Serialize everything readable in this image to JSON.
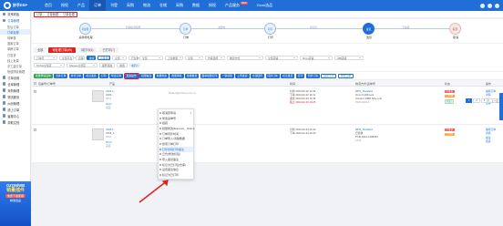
{
  "brand": {
    "name": "妙手ERP"
  },
  "topnav": {
    "items": [
      {
        "label": "首页"
      },
      {
        "label": "授权"
      },
      {
        "label": "产品"
      },
      {
        "label": "订单"
      },
      {
        "label": "刊登"
      },
      {
        "label": "采购"
      },
      {
        "label": "物流"
      },
      {
        "label": "仓储"
      },
      {
        "label": "采购"
      },
      {
        "label": "数据"
      },
      {
        "label": "授权"
      },
      {
        "label": "产品服务"
      },
      {
        "label": "Ozon选品"
      }
    ],
    "badge": "NEW"
  },
  "sidebar": {
    "sections": [
      {
        "label": "效率看板"
      },
      {
        "label": "订单管理"
      },
      {
        "label": "售后订单"
      },
      {
        "label": "订单处理"
      },
      {
        "label": "待审核"
      },
      {
        "label": "退款订单"
      },
      {
        "label": "草稿订单"
      },
      {
        "label": "已发货"
      },
      {
        "label": "线上批量"
      },
      {
        "label": "手工建订单"
      },
      {
        "label": "快递揽收管理"
      },
      {
        "label": "订单设置"
      },
      {
        "label": "仓库管理"
      },
      {
        "label": "采购管理"
      },
      {
        "label": "物流服务"
      },
      {
        "label": "纠纷管理"
      },
      {
        "label": "线上订单"
      },
      {
        "label": "客服中心"
      },
      {
        "label": "帮助文档"
      }
    ]
  },
  "promo": {
    "line1": "OZON/WB",
    "line2": "销量插件",
    "cta": "免费下载使用",
    "line4": "精准选品"
  },
  "breadcrumb": {
    "items": [
      "订单",
      "订单管理",
      "订单处理"
    ]
  },
  "flow": {
    "nodes": [
      "待处理",
      "订单",
      "打印",
      "发货",
      "取消"
    ],
    "labels": [
      "采购待处理",
      "订单",
      "打印",
      "发货",
      "取消"
    ],
    "hints": [
      "待审核/待处理",
      "处理中",
      "待打包",
      "已发货"
    ]
  },
  "tabs": [
    {
      "label": "全部",
      "count": "",
      "active": false
    },
    {
      "label": "待处理订单",
      "count": "(69)",
      "active": true
    },
    {
      "label": "待打印",
      "count": "(4)",
      "active": false
    },
    {
      "label": "已打印",
      "count": "(7)",
      "active": false
    }
  ],
  "filters": {
    "row1": [
      "订单号",
      "全部平台",
      "店铺",
      "搜索",
      "高级搜索",
      "全部",
      "已付款",
      "全部",
      "上架类型",
      "全部",
      "仓库选择",
      "物流方式",
      "全部店铺",
      "Ozon店铺",
      "WB店铺"
    ],
    "row2": [
      "TikTok全部店",
      "Shopee全部店",
      "展开筛选",
      "重置"
    ],
    "tag": "未配对"
  },
  "toolbar": {
    "buttons": [
      "批量申请运单",
      "合并订单",
      "拆分订单",
      "标记发货",
      "打印",
      "导出订单",
      "更多操作",
      "批量备注",
      "批量修改",
      "批量审核",
      "批量推送",
      "面单批量打印",
      "一键获取",
      "上传发货",
      "全部回传",
      "同步订单",
      "标记发货",
      "打印",
      "同步订单",
      "自定义列",
      "导出订单"
    ]
  },
  "table": {
    "headers": [
      "包裹号/订单号",
      "产品",
      "时间",
      "物流方式/运单号",
      "状态",
      "操作"
    ],
    "rows": [
      {
        "order_no": "2104-1-",
        "order_sub": "2103...",
        "sku_label": "SKU:",
        "platform": "Ozon",
        "tag": "来自",
        "email_mask": "hidden@privacy.ozon.ru",
        "time1": "付款 2024-02-22 11:06",
        "time2": "下单 2024-02-22 11:11",
        "time3": "发货 2024-02-23 11:06",
        "time4": "截止 2024-02-23 19:25",
        "logistics": "MPS_Standard",
        "logistics2": "Ozon Fulfillment",
        "logistics3": "Amazon FBM Ship (+2)",
        "logistics4": "PCR-0321-1",
        "status_tags": [
          "待发货",
          "已付款",
          "标记"
        ],
        "actions": [
          "编辑订单",
          "详情",
          "备注",
          "更多"
        ]
      },
      {
        "order_no": "3104-1-",
        "order_sub": "3154_1...",
        "sku_label": "SKU:",
        "platform": "Ozon",
        "tag": "来自",
        "email_mask": "",
        "time1": "付款 2024-02-24 16:42",
        "time2": "下单 2024-02-24 16:43",
        "time3": "",
        "time4": "",
        "logistics": "MPS_Standard",
        "logistics2": "已揽收",
        "logistics3": "PCR-0321-1298401",
        "logistics4": "1234",
        "status_tags": [
          "待发货",
          "已付款"
        ],
        "actions": [
          "编辑订单",
          "详情",
          "备注",
          "更多"
        ]
      }
    ]
  },
  "dropdown": {
    "items": [
      {
        "label": "取消原申请",
        "highlight": false
      },
      {
        "label": "修改运单号",
        "highlight": false
      },
      {
        "label": "挂起",
        "highlight": false
      },
      {
        "label": "批量修改(Express、Zoom)",
        "highlight": false
      },
      {
        "label": "订单同步时间",
        "highlight": false
      },
      {
        "label": "订单导入/清除数据",
        "highlight": false
      },
      {
        "label": "搜索订单打印",
        "highlight": false
      },
      {
        "label": "打印条码打印备注",
        "highlight": true
      },
      {
        "label": "云仓(修改标签)",
        "highlight": false
      },
      {
        "label": "导入备货备注",
        "highlight": false
      },
      {
        "label": "标记为已打包(仓库)",
        "highlight": false
      },
      {
        "label": "设置备注信息",
        "highlight": false
      },
      {
        "label": "标记为已打印",
        "highlight": false
      }
    ]
  },
  "pager": {
    "labels": [
      "1",
      "2",
      "3",
      "下一页"
    ]
  },
  "colors": {
    "brand": "#1f6fd6",
    "accent": "#e02020",
    "success": "#2fa84f"
  }
}
